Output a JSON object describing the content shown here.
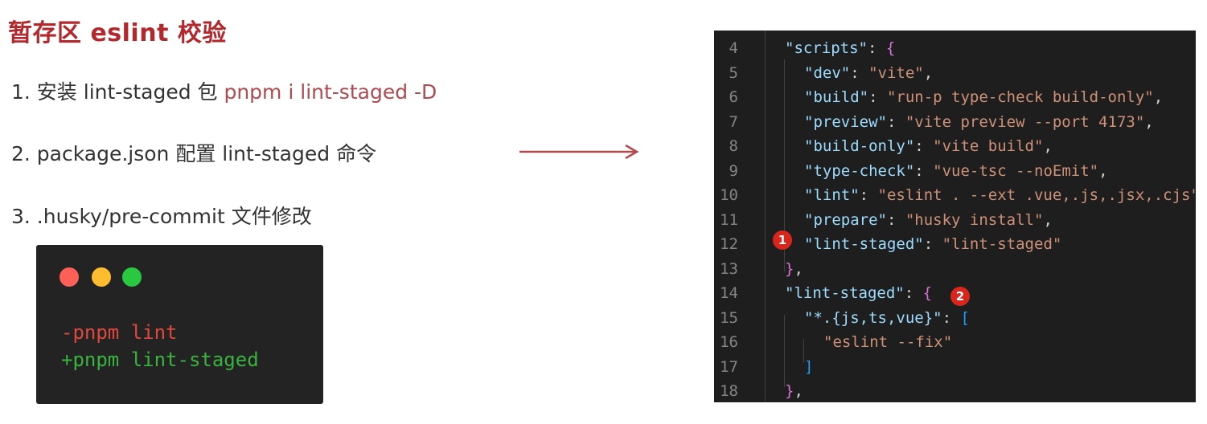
{
  "slide": {
    "title": "暂存区 eslint 校验",
    "steps": [
      {
        "text": "1. 安装 lint-staged 包 ",
        "highlight": "pnpm i lint-staged -D"
      },
      {
        "text": "2. package.json 配置 lint-staged 命令",
        "highlight": ""
      },
      {
        "text": "3. .husky/pre-commit 文件修改",
        "highlight": ""
      }
    ]
  },
  "terminal": {
    "removed_line": "-pnpm lint",
    "added_line": "+pnpm lint-staged"
  },
  "editor": {
    "lines": [
      {
        "num": "4",
        "indent": 1,
        "tokens": [
          [
            "k",
            "\"scripts\""
          ],
          [
            "p",
            ": "
          ],
          [
            "b1",
            "{"
          ]
        ]
      },
      {
        "num": "5",
        "indent": 2,
        "tokens": [
          [
            "k",
            "\"dev\""
          ],
          [
            "p",
            ": "
          ],
          [
            "s",
            "\"vite\""
          ],
          [
            "p",
            ","
          ]
        ]
      },
      {
        "num": "6",
        "indent": 2,
        "tokens": [
          [
            "k",
            "\"build\""
          ],
          [
            "p",
            ": "
          ],
          [
            "s",
            "\"run-p type-check build-only\""
          ],
          [
            "p",
            ","
          ]
        ]
      },
      {
        "num": "7",
        "indent": 2,
        "tokens": [
          [
            "k",
            "\"preview\""
          ],
          [
            "p",
            ": "
          ],
          [
            "s",
            "\"vite preview --port 4173\""
          ],
          [
            "p",
            ","
          ]
        ]
      },
      {
        "num": "8",
        "indent": 2,
        "tokens": [
          [
            "k",
            "\"build-only\""
          ],
          [
            "p",
            ": "
          ],
          [
            "s",
            "\"vite build\""
          ],
          [
            "p",
            ","
          ]
        ]
      },
      {
        "num": "9",
        "indent": 2,
        "tokens": [
          [
            "k",
            "\"type-check\""
          ],
          [
            "p",
            ": "
          ],
          [
            "s",
            "\"vue-tsc --noEmit\""
          ],
          [
            "p",
            ","
          ]
        ]
      },
      {
        "num": "10",
        "indent": 2,
        "tokens": [
          [
            "k",
            "\"lint\""
          ],
          [
            "p",
            ": "
          ],
          [
            "s",
            "\"eslint . --ext .vue,.js,.jsx,.cjs\""
          ]
        ]
      },
      {
        "num": "11",
        "indent": 2,
        "tokens": [
          [
            "k",
            "\"prepare\""
          ],
          [
            "p",
            ": "
          ],
          [
            "s",
            "\"husky install\""
          ],
          [
            "p",
            ","
          ]
        ]
      },
      {
        "num": "12",
        "indent": 2,
        "tokens": [
          [
            "k",
            "\"lint-staged\""
          ],
          [
            "p",
            ": "
          ],
          [
            "s",
            "\"lint-staged\""
          ]
        ]
      },
      {
        "num": "13",
        "indent": 1,
        "tokens": [
          [
            "b1",
            "}"
          ],
          [
            "p",
            ","
          ]
        ]
      },
      {
        "num": "14",
        "indent": 1,
        "tokens": [
          [
            "k",
            "\"lint-staged\""
          ],
          [
            "p",
            ": "
          ],
          [
            "b1",
            "{"
          ]
        ]
      },
      {
        "num": "15",
        "indent": 2,
        "tokens": [
          [
            "k",
            "\"*.{js,ts,vue}\""
          ],
          [
            "p",
            ": "
          ],
          [
            "b2",
            "["
          ]
        ]
      },
      {
        "num": "16",
        "indent": 3,
        "tokens": [
          [
            "s",
            "\"eslint --fix\""
          ]
        ]
      },
      {
        "num": "17",
        "indent": 2,
        "tokens": [
          [
            "b2",
            "]"
          ]
        ]
      },
      {
        "num": "18",
        "indent": 1,
        "tokens": [
          [
            "b1",
            "}"
          ],
          [
            "p",
            ","
          ]
        ]
      }
    ],
    "badges": [
      "1",
      "2"
    ]
  },
  "colors": {
    "title": "#b3282d",
    "highlight": "#b04a4f",
    "arrow": "#b04a4f",
    "terminal_bg": "#232323",
    "editor_bg": "#1e1e1e",
    "badge": "#d9261c"
  }
}
